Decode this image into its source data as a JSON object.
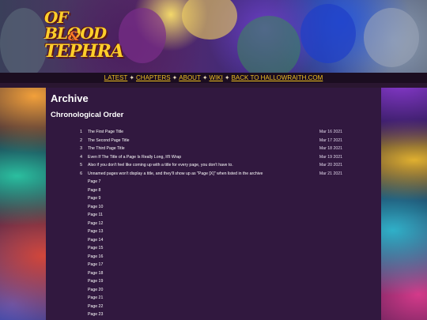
{
  "nav": {
    "items": [
      "LATEST",
      "CHAPTERS",
      "ABOUT",
      "WIKI",
      "BACK TO HALLOWRAITH.COM"
    ],
    "separator": "✦"
  },
  "logo": {
    "line1": "OF BLOOD",
    "line2": "&",
    "line3": "TEPHRA"
  },
  "archive": {
    "title": "Archive",
    "subtitle": "Chronological Order",
    "entries": [
      {
        "num": "1",
        "title": "The First Page Title",
        "date": "Mar 16 2021"
      },
      {
        "num": "2",
        "title": "The Second Page Title",
        "date": "Mar 17 2021"
      },
      {
        "num": "3",
        "title": "The Third Page Title",
        "date": "Mar 18 2021"
      },
      {
        "num": "4",
        "title": "Even If The Title of a Page Is Really Long, It'll Wrap",
        "date": "Mar 19 2021"
      },
      {
        "num": "5",
        "title": "Also if you don't feel like coming up with a title for every page, you don't have to.",
        "date": "Mar 20 2021"
      },
      {
        "num": "6",
        "title": "Unnamed pages won't display a title, and they'll show up as \"Page [X]\" when listed in the archive",
        "date": "Mar 21 2021"
      },
      {
        "num": "",
        "title": "Page 7",
        "date": ""
      },
      {
        "num": "",
        "title": "Page 8",
        "date": ""
      },
      {
        "num": "",
        "title": "Page 9",
        "date": ""
      },
      {
        "num": "",
        "title": "Page 10",
        "date": ""
      },
      {
        "num": "",
        "title": "Page 11",
        "date": ""
      },
      {
        "num": "",
        "title": "Page 12",
        "date": ""
      },
      {
        "num": "",
        "title": "Page 13",
        "date": ""
      },
      {
        "num": "",
        "title": "Page 14",
        "date": ""
      },
      {
        "num": "",
        "title": "Page 15",
        "date": ""
      },
      {
        "num": "",
        "title": "Page 16",
        "date": ""
      },
      {
        "num": "",
        "title": "Page 17",
        "date": ""
      },
      {
        "num": "",
        "title": "Page 18",
        "date": ""
      },
      {
        "num": "",
        "title": "Page 19",
        "date": ""
      },
      {
        "num": "",
        "title": "Page 20",
        "date": ""
      },
      {
        "num": "",
        "title": "Page 21",
        "date": ""
      },
      {
        "num": "",
        "title": "Page 22",
        "date": ""
      },
      {
        "num": "",
        "title": "Page 23",
        "date": ""
      }
    ]
  },
  "colors": {
    "nav_link": "#f0c020",
    "panel_bg": "#31183f",
    "navbar_bg": "#1b0d20"
  }
}
